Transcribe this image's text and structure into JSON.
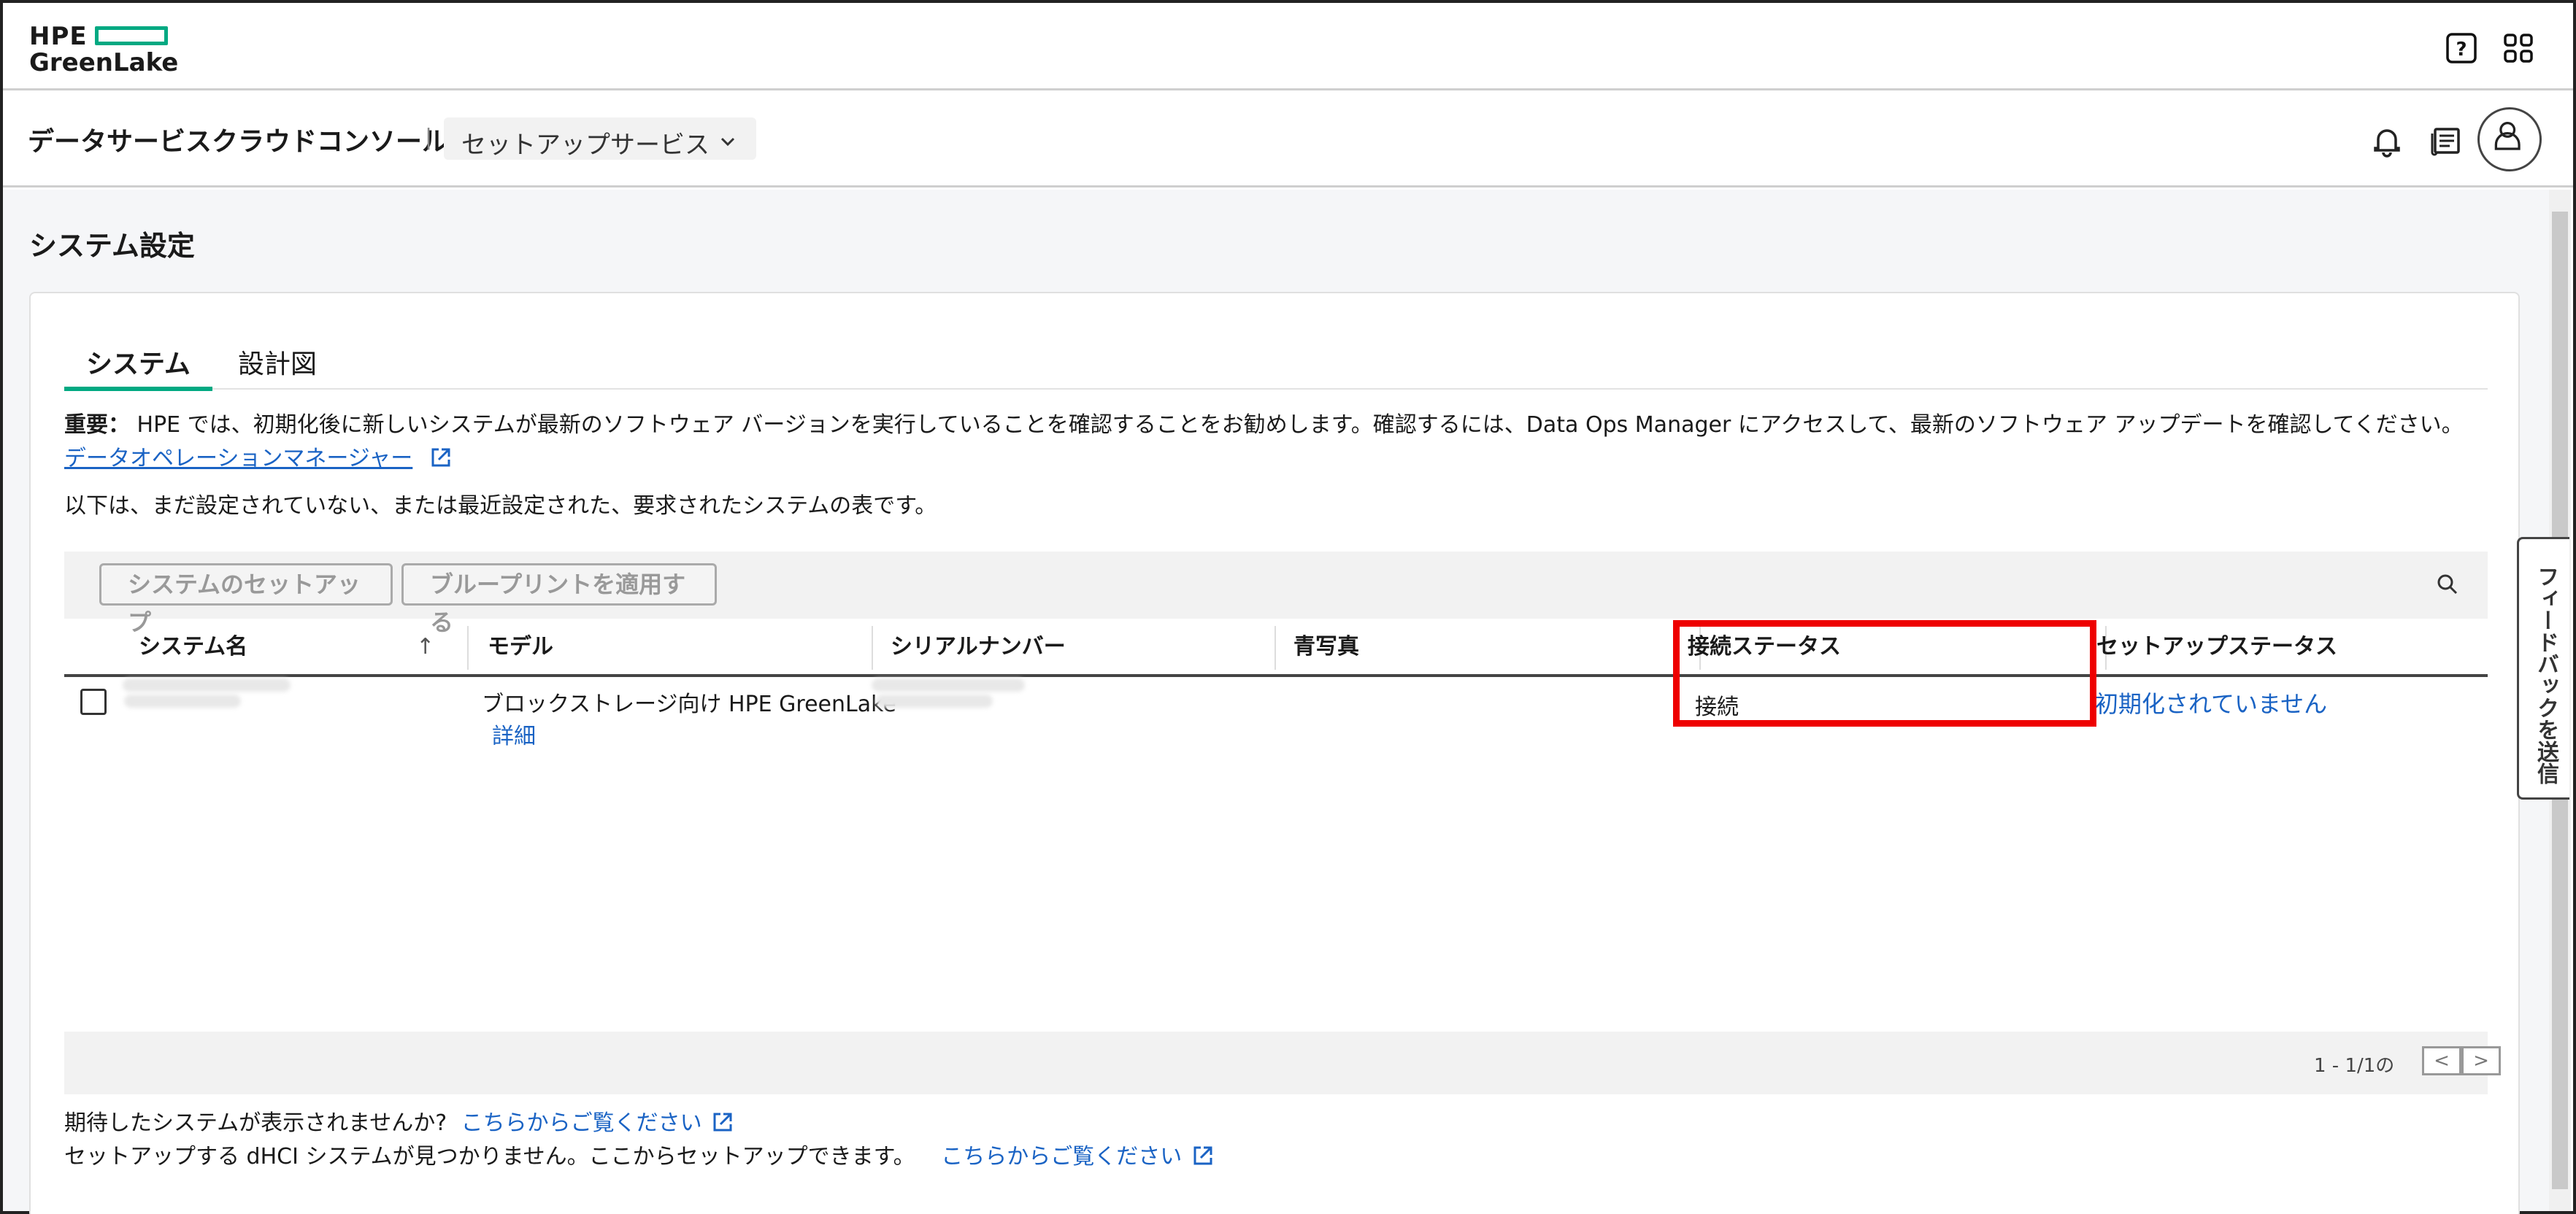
{
  "header": {
    "logo_line1": "HPE",
    "logo_line2": "GreenLake",
    "help_icon": "help-icon",
    "apps_icon": "apps-grid-icon"
  },
  "subheader": {
    "app_title": "データサービスクラウドコンソール",
    "separator": "|",
    "service_select": "セットアップサービス",
    "bell_icon": "bell-icon",
    "news_icon": "news-icon",
    "avatar_icon": "user-avatar-icon"
  },
  "page": {
    "title": "システム設定",
    "tabs": [
      {
        "label": "システム",
        "active": true
      },
      {
        "label": "設計図",
        "active": false
      }
    ],
    "notice_label": "重要：",
    "notice_text": " HPE では、初期化後に新しいシステムが最新のソフトウェア バージョンを実行していることを確認することをお勧めします。確認するには、Data Ops Manager にアクセスして、最新のソフトウェア アップデートを確認してください。",
    "notice_link": "データオペレーションマネージャー",
    "description": "以下は、まだ設定されていない、または最近設定された、要求されたシステムの表です。",
    "buttons": {
      "setup": "システムのセットアップ",
      "apply_blueprint": "ブループリントを適用する"
    },
    "table": {
      "columns": [
        "システム名",
        "モデル",
        "シリアルナンバー",
        "青写真",
        "接続ステータス",
        "セットアップステータス"
      ],
      "sort_indicator": "↑",
      "rows": [
        {
          "system_name": "",
          "model": "ブロックストレージ向け HPE GreenLake",
          "model_link": "詳細",
          "serial": "",
          "blueprint": "",
          "connection": "接続",
          "setup_status": "初期化されていません"
        }
      ]
    },
    "pagination": {
      "info": "1 - 1/1の",
      "prev": "<",
      "next": ">"
    },
    "footer": {
      "line1_text": "期待したシステムが表示されませんか?",
      "line1_link": "こちらからご覧ください",
      "line2_text": "セットアップする dHCI システムが見つかりません。ここからセットアップできます。",
      "line2_link": "こちらからご覧ください"
    },
    "feedback_label": "フィードバックを送信"
  },
  "colors": {
    "accent": "#01a982",
    "link": "#1a63c4",
    "highlight": "#ee0000"
  }
}
